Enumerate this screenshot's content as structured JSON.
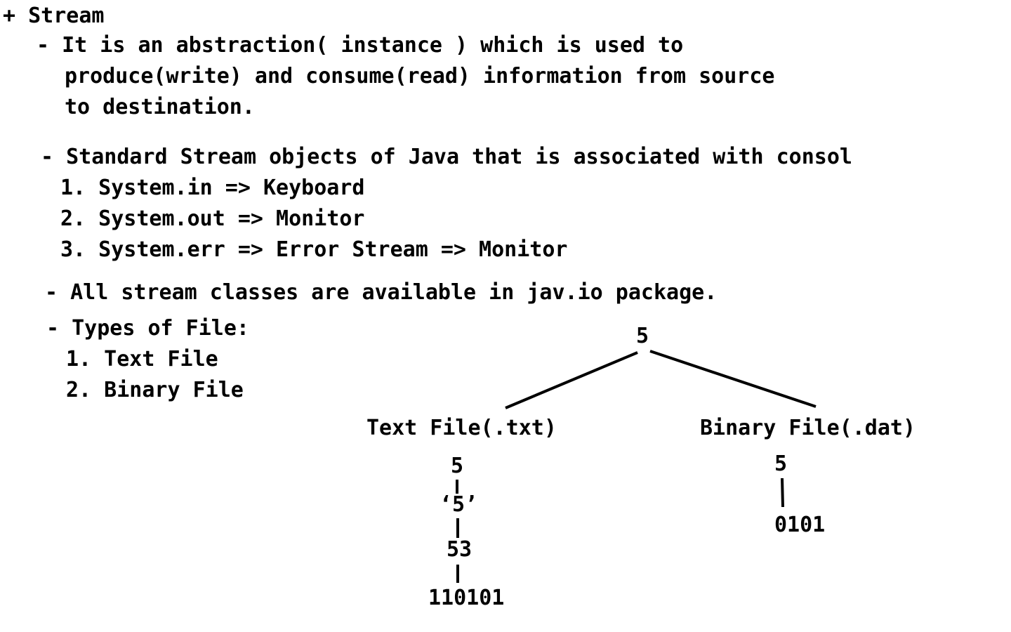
{
  "heading": "+ Stream",
  "definition": {
    "lines": [
      "- It is an abstraction( instance ) which is used to",
      "produce(write) and consume(read) information from source",
      "to destination."
    ]
  },
  "standard_streams": {
    "intro": "- Standard Stream objects of Java that is associated with consol",
    "items": [
      "1. System.in => Keyboard",
      "2. System.out => Monitor",
      "3. System.err => Error Stream => Monitor"
    ]
  },
  "package_note": "- All stream classes are available in jav.io package.",
  "file_types": {
    "intro": "- Types of File:",
    "items": [
      "1. Text File",
      "2. Binary File"
    ]
  },
  "diagram": {
    "root": "5",
    "text_branch": {
      "label": "Text File(.txt)",
      "chain": [
        "5",
        "‘5’",
        "53",
        "110101"
      ]
    },
    "binary_branch": {
      "label": "Binary File(.dat)",
      "chain": [
        "5",
        "0101"
      ]
    }
  }
}
